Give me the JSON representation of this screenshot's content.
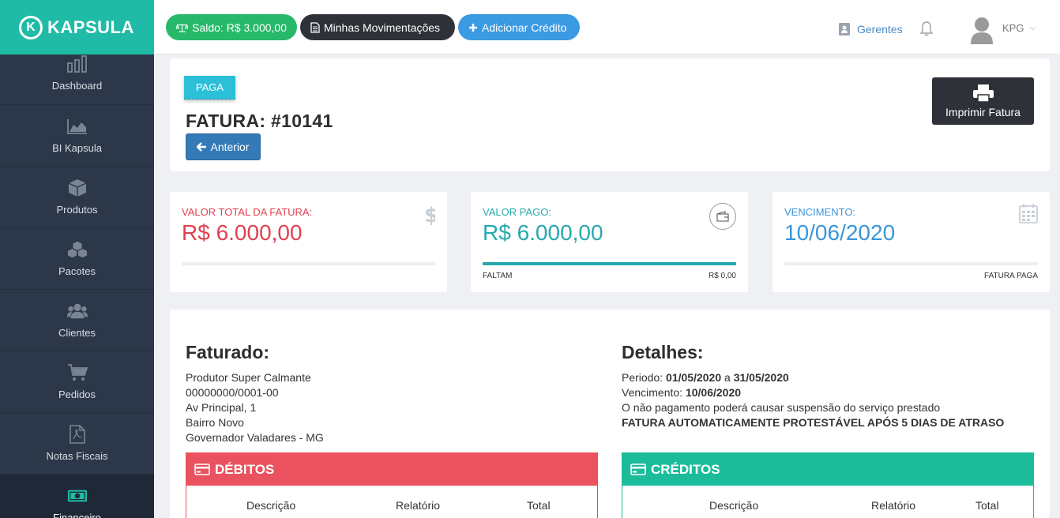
{
  "brand": {
    "name": "KAPSULA",
    "logo_letter": "K",
    "color": "#1fbba6"
  },
  "sidebar": {
    "items": [
      {
        "label": "Dashboard",
        "icon": "bar-chart-icon"
      },
      {
        "label": "BI Kapsula",
        "icon": "area-chart-icon"
      },
      {
        "label": "Produtos",
        "icon": "cube-icon"
      },
      {
        "label": "Pacotes",
        "icon": "cubes-icon"
      },
      {
        "label": "Clientes",
        "icon": "users-icon"
      },
      {
        "label": "Pedidos",
        "icon": "cart-icon"
      },
      {
        "label": "Notas Fiscais",
        "icon": "pdf-file-icon"
      },
      {
        "label": "Financeiro",
        "icon": "money-icon",
        "active": true
      }
    ]
  },
  "topbar": {
    "saldo": "Saldo: R$ 3.000,00",
    "movimentacoes": "Minhas Movimentações",
    "adicionar": "Adicionar Crédito",
    "gerentes": "Gerentes",
    "user": "KPG"
  },
  "header": {
    "status": "PAGA",
    "title": "FATURA: #10141",
    "back_button": "Anterior",
    "print_button": "Imprimir Fatura"
  },
  "stats": {
    "total": {
      "label": "VALOR TOTAL DA FATURA:",
      "value": "R$ 6.000,00",
      "icon": "dollar-icon",
      "progress": 0
    },
    "pago": {
      "label": "VALOR PAGO:",
      "value": "R$ 6.000,00",
      "icon": "wallet-icon",
      "progress": 1.0,
      "foot_left": "FALTAM",
      "foot_right": "R$ 0,00"
    },
    "vencimento": {
      "label": "VENCIMENTO:",
      "value": "10/06/2020",
      "icon": "calendar-icon",
      "progress": 0,
      "foot_right": "FATURA PAGA"
    }
  },
  "faturado": {
    "title": "Faturado:",
    "lines": [
      "Produtor Super Calmante",
      "00000000/0001-00",
      "Av Principal, 1",
      "Bairro Novo",
      "Governador Valadares - MG"
    ]
  },
  "detalhes": {
    "title": "Detalhes:",
    "periodo_label": "Periodo:",
    "periodo_inicio": "01/05/2020",
    "periodo_sep": "a",
    "periodo_fim": "31/05/2020",
    "vencimento_label": "Vencimento:",
    "vencimento": "10/06/2020",
    "aviso": "O não pagamento poderá causar suspensão do serviço prestado",
    "protesto": "FATURA AUTOMATICAMENTE PROTESTÁVEL APÓS 5 DIAS DE ATRASO"
  },
  "debitos": {
    "title": "DÉBITOS",
    "columns": [
      "Descrição",
      "Relatório",
      "Total"
    ]
  },
  "creditos": {
    "title": "CRÉDITOS",
    "columns": [
      "Descrição",
      "Relatório",
      "Total"
    ]
  }
}
